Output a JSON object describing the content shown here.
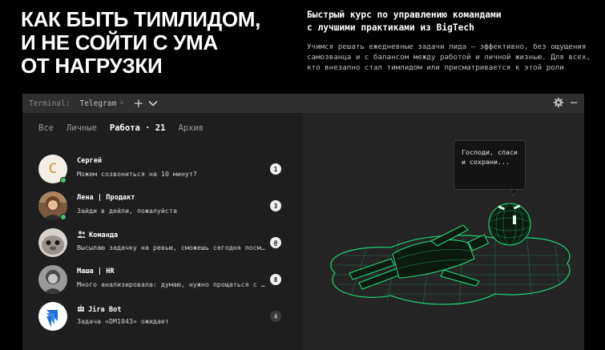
{
  "hero": {
    "headline": [
      "КАК БЫТЬ ТИМЛИДОМ,",
      "И НЕ СОЙТИ С УМА",
      "ОТ НАГРУЗКИ"
    ],
    "subtitle": [
      "Быстрый курс по управлению командами",
      "с лучшими практиками из BigTech"
    ],
    "description": [
      "Учимся решать ежедневные задачи лида — эффективно, без ощущения",
      "самозванца и с балансом между работой и личной жизнью. Для всех,",
      "кто внезапно стал тимлидом или присматривается к этой роли"
    ]
  },
  "terminal": {
    "label": "Terminal:",
    "tab": "Telegram",
    "tab_close": "×",
    "plus": "+"
  },
  "tabs": [
    {
      "label": "Все"
    },
    {
      "label": "Личные"
    },
    {
      "label": "Работа · 21"
    },
    {
      "label": "Архив"
    }
  ],
  "chats": [
    {
      "name": "Сергей",
      "avatar_letter": "С",
      "message": "Можем созвониться на 10 минут?",
      "badge": "1"
    },
    {
      "name": "Лена | Продакт",
      "message": "Зайди в дейли, пожалуйста",
      "badge": "3"
    },
    {
      "name": "Команда",
      "icon": "group-icon",
      "message": "Высылаю задачку на ревью, сможешь сегодня посмотреть?",
      "badge": "@"
    },
    {
      "name": "Маша | HR",
      "message": "Много анализировала: думаю, нужно прощаться с ним",
      "badge": "8"
    },
    {
      "name": "Jira Bot",
      "icon": "bot-icon",
      "message": "Задача «DM1043» ожидает",
      "badge": "4"
    }
  ],
  "bubble": [
    "Господи, спаси",
    "и сохрани..."
  ],
  "colors": {
    "online": "#3ec46d",
    "wireframe": "#1fe07a",
    "sergey_avatar": "#c9912c",
    "jira": "#1f6fe0"
  }
}
